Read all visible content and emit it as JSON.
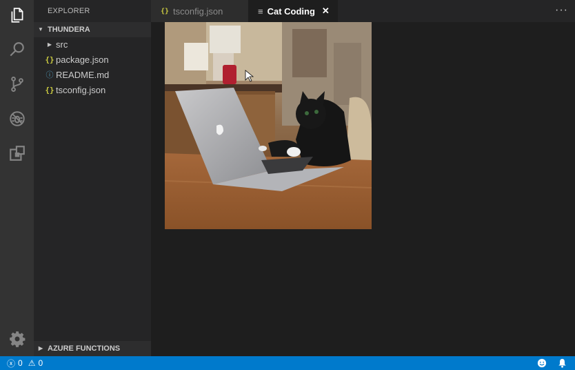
{
  "sidebar": {
    "title": "EXPLORER",
    "project": "THUNDERA",
    "items": [
      {
        "label": "src",
        "icon": "chevron-right-icon"
      },
      {
        "label": "package.json",
        "icon": "json-braces-icon"
      },
      {
        "label": "README.md",
        "icon": "info-icon"
      },
      {
        "label": "tsconfig.json",
        "icon": "json-braces-icon"
      }
    ],
    "bottom_section": "AZURE FUNCTIONS"
  },
  "tabs": [
    {
      "label": "tsconfig.json",
      "icon": "{}"
    },
    {
      "label": "Cat Coding",
      "icon": "≡",
      "active": true,
      "close": "✕"
    }
  ],
  "more_actions": "···",
  "statusbar": {
    "errors": "0",
    "warnings": "0",
    "error_icon": "ⓧ",
    "warning_icon": "⚠"
  },
  "colors": {
    "accent": "#007acc",
    "activity_bar": "#333333",
    "sidebar": "#252526",
    "editor": "#1e1e1e",
    "json_icon": "#cbcb41",
    "info_icon": "#519aba"
  }
}
